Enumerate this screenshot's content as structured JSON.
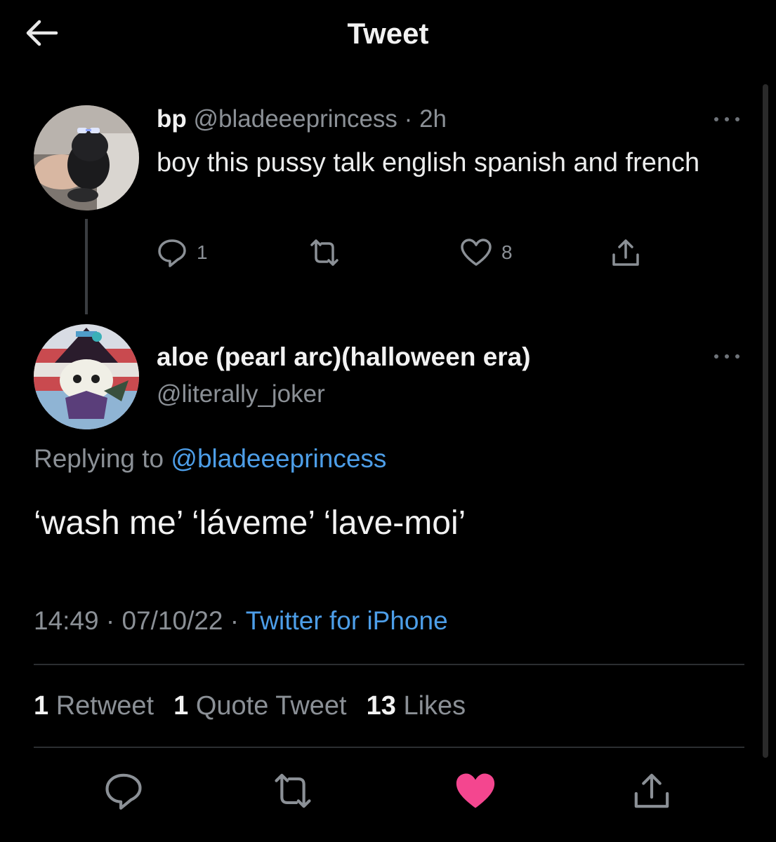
{
  "header": {
    "title": "Tweet",
    "back_icon": "arrow-left-icon"
  },
  "parent_tweet": {
    "display_name": "bp",
    "handle": "@bladeeeprincess",
    "separator": "·",
    "time": "2h",
    "text": "boy this pussy talk english spanish and french",
    "reply_count": "1",
    "like_count": "8",
    "icons": [
      "reply-icon",
      "retweet-icon",
      "like-icon",
      "share-icon"
    ]
  },
  "main_tweet": {
    "display_name": "aloe (pearl arc)(halloween era)",
    "handle": "@literally_joker",
    "replying_prefix": "Replying to",
    "replying_handle": "@bladeeeprincess",
    "text": "‘wash me’ ‘láveme’ ‘lave-moi’",
    "time": "14:49",
    "date": "07/10/22",
    "separator": "·",
    "source": "Twitter for iPhone"
  },
  "stats": {
    "retweets_count": "1",
    "retweets_label": "Retweet",
    "quotes_count": "1",
    "quotes_label": "Quote Tweet",
    "likes_count": "13",
    "likes_label": "Likes"
  },
  "colors": {
    "background": "#000000",
    "link": "#4d9ee8",
    "liked": "#f4468f",
    "muted": "#8b9096"
  }
}
